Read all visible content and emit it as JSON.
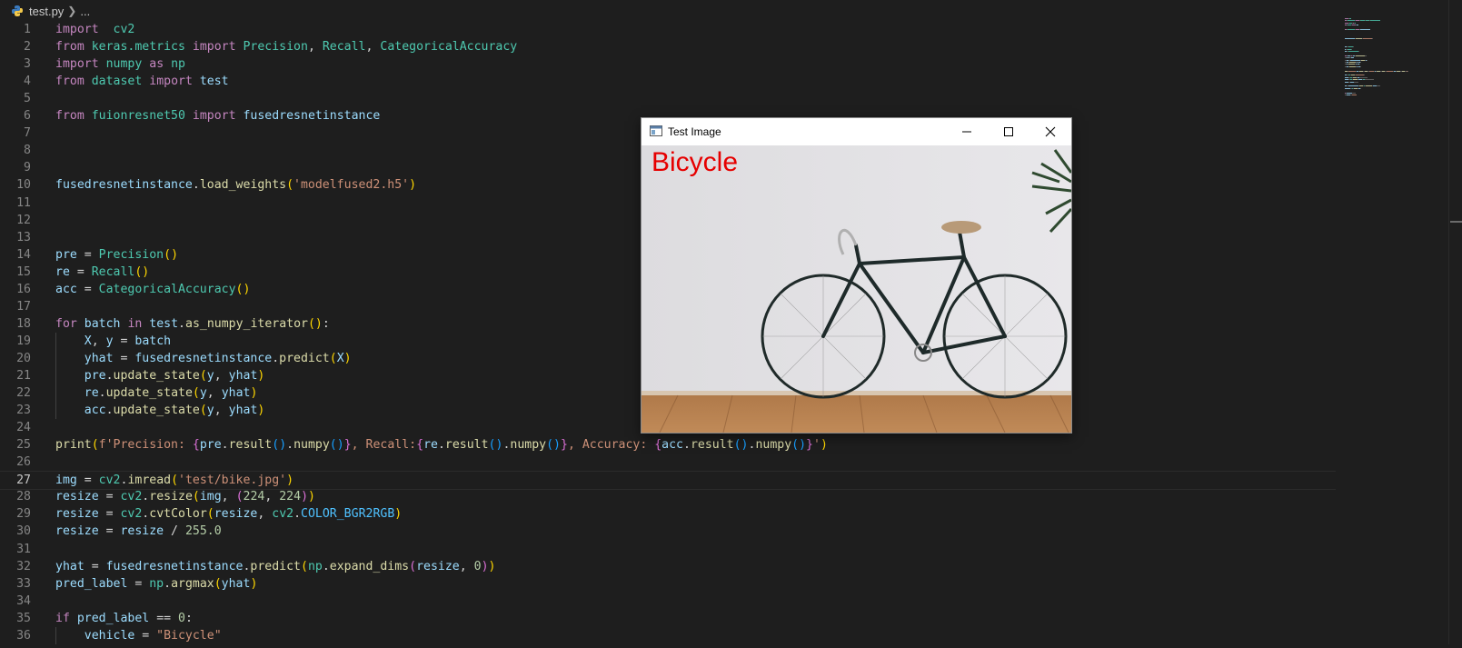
{
  "breadcrumb": {
    "file": "test.py",
    "more": "..."
  },
  "editor": {
    "active_line": 27,
    "lines": [
      {
        "n": "1",
        "tokens": [
          [
            "k",
            "import"
          ],
          [
            "",
            "  "
          ],
          [
            "c",
            "cv2"
          ]
        ]
      },
      {
        "n": "2",
        "tokens": [
          [
            "k",
            "from"
          ],
          [
            "",
            ""
          ],
          [
            "c",
            "keras.metrics"
          ],
          [
            "",
            ""
          ],
          [
            "k",
            "import"
          ],
          [
            "",
            ""
          ],
          [
            "c",
            "Precision"
          ],
          [
            "",
            ", "
          ],
          [
            "c",
            "Recall"
          ],
          [
            "",
            ", "
          ],
          [
            "c",
            "CategoricalAccuracy"
          ]
        ]
      },
      {
        "n": "3",
        "tokens": [
          [
            "k",
            "import"
          ],
          [
            "",
            ""
          ],
          [
            "c",
            "numpy"
          ],
          [
            "",
            ""
          ],
          [
            "k",
            "as"
          ],
          [
            "",
            ""
          ],
          [
            "c",
            "np"
          ]
        ]
      },
      {
        "n": "4",
        "tokens": [
          [
            "k",
            "from"
          ],
          [
            "",
            ""
          ],
          [
            "c",
            "dataset"
          ],
          [
            "",
            ""
          ],
          [
            "k",
            "import"
          ],
          [
            "",
            ""
          ],
          [
            "v",
            "test"
          ]
        ]
      },
      {
        "n": "5",
        "tokens": []
      },
      {
        "n": "6",
        "tokens": [
          [
            "k",
            "from"
          ],
          [
            "",
            ""
          ],
          [
            "c",
            "fuionresnet50"
          ],
          [
            "",
            ""
          ],
          [
            "k",
            "import"
          ],
          [
            "",
            ""
          ],
          [
            "v",
            "fusedresnetinstance"
          ]
        ]
      },
      {
        "n": "7",
        "tokens": []
      },
      {
        "n": "8",
        "tokens": []
      },
      {
        "n": "9",
        "tokens": []
      },
      {
        "n": "10",
        "tokens": [
          [
            "v",
            "fusedresnetinstance"
          ],
          [
            "",
            "."
          ],
          [
            "f",
            "load_weights"
          ],
          [
            "b1",
            "("
          ],
          [
            "s",
            "'modelfused2.h5'"
          ],
          [
            "b1",
            ")"
          ]
        ]
      },
      {
        "n": "11",
        "tokens": []
      },
      {
        "n": "12",
        "tokens": []
      },
      {
        "n": "13",
        "tokens": []
      },
      {
        "n": "14",
        "tokens": [
          [
            "v",
            "pre"
          ],
          [
            "",
            " = "
          ],
          [
            "c",
            "Precision"
          ],
          [
            "b1",
            "()"
          ]
        ]
      },
      {
        "n": "15",
        "tokens": [
          [
            "v",
            "re"
          ],
          [
            "",
            " = "
          ],
          [
            "c",
            "Recall"
          ],
          [
            "b1",
            "()"
          ]
        ]
      },
      {
        "n": "16",
        "tokens": [
          [
            "v",
            "acc"
          ],
          [
            "",
            " = "
          ],
          [
            "c",
            "CategoricalAccuracy"
          ],
          [
            "b1",
            "()"
          ]
        ]
      },
      {
        "n": "17",
        "tokens": []
      },
      {
        "n": "18",
        "tokens": [
          [
            "k",
            "for"
          ],
          [
            "",
            " "
          ],
          [
            "v",
            "batch"
          ],
          [
            "",
            " "
          ],
          [
            "k",
            "in"
          ],
          [
            "",
            " "
          ],
          [
            "v",
            "test"
          ],
          [
            "",
            "."
          ],
          [
            "f",
            "as_numpy_iterator"
          ],
          [
            "b1",
            "()"
          ],
          [
            "",
            ":"
          ]
        ]
      },
      {
        "n": "19",
        "tokens": [
          [
            "",
            "    "
          ],
          [
            "v",
            "X"
          ],
          [
            "",
            ", "
          ],
          [
            "v",
            "y"
          ],
          [
            "",
            " = "
          ],
          [
            "v",
            "batch"
          ]
        ]
      },
      {
        "n": "20",
        "tokens": [
          [
            "",
            "    "
          ],
          [
            "v",
            "yhat"
          ],
          [
            "",
            " = "
          ],
          [
            "v",
            "fusedresnetinstance"
          ],
          [
            "",
            "."
          ],
          [
            "f",
            "predict"
          ],
          [
            "b1",
            "("
          ],
          [
            "v",
            "X"
          ],
          [
            "b1",
            ")"
          ]
        ]
      },
      {
        "n": "21",
        "tokens": [
          [
            "",
            "    "
          ],
          [
            "v",
            "pre"
          ],
          [
            "",
            "."
          ],
          [
            "f",
            "update_state"
          ],
          [
            "b1",
            "("
          ],
          [
            "v",
            "y"
          ],
          [
            "",
            ", "
          ],
          [
            "v",
            "yhat"
          ],
          [
            "b1",
            ")"
          ]
        ]
      },
      {
        "n": "22",
        "tokens": [
          [
            "",
            "    "
          ],
          [
            "v",
            "re"
          ],
          [
            "",
            "."
          ],
          [
            "f",
            "update_state"
          ],
          [
            "b1",
            "("
          ],
          [
            "v",
            "y"
          ],
          [
            "",
            ", "
          ],
          [
            "v",
            "yhat"
          ],
          [
            "b1",
            ")"
          ]
        ]
      },
      {
        "n": "23",
        "tokens": [
          [
            "",
            "    "
          ],
          [
            "v",
            "acc"
          ],
          [
            "",
            "."
          ],
          [
            "f",
            "update_state"
          ],
          [
            "b1",
            "("
          ],
          [
            "v",
            "y"
          ],
          [
            "",
            ", "
          ],
          [
            "v",
            "yhat"
          ],
          [
            "b1",
            ")"
          ]
        ]
      },
      {
        "n": "24",
        "tokens": []
      },
      {
        "n": "25",
        "tokens": [
          [
            "f",
            "print"
          ],
          [
            "b1",
            "("
          ],
          [
            "s",
            "f'Precision: "
          ],
          [
            "b2",
            "{"
          ],
          [
            "v",
            "pre"
          ],
          [
            "",
            "."
          ],
          [
            "f",
            "result"
          ],
          [
            "b3",
            "()"
          ],
          [
            "",
            "."
          ],
          [
            "f",
            "numpy"
          ],
          [
            "b3",
            "()"
          ],
          [
            "b2",
            "}"
          ],
          [
            "s",
            ", Recall:"
          ],
          [
            "b2",
            "{"
          ],
          [
            "v",
            "re"
          ],
          [
            "",
            "."
          ],
          [
            "f",
            "result"
          ],
          [
            "b3",
            "()"
          ],
          [
            "",
            "."
          ],
          [
            "f",
            "numpy"
          ],
          [
            "b3",
            "()"
          ],
          [
            "b2",
            "}"
          ],
          [
            "s",
            ", Accuracy: "
          ],
          [
            "b2",
            "{"
          ],
          [
            "v",
            "acc"
          ],
          [
            "",
            "."
          ],
          [
            "f",
            "result"
          ],
          [
            "b3",
            "()"
          ],
          [
            "",
            "."
          ],
          [
            "f",
            "numpy"
          ],
          [
            "b3",
            "()"
          ],
          [
            "b2",
            "}"
          ],
          [
            "s",
            "'"
          ],
          [
            "b1",
            ")"
          ]
        ]
      },
      {
        "n": "26",
        "tokens": []
      },
      {
        "n": "27",
        "tokens": [
          [
            "v",
            "img"
          ],
          [
            "",
            " = "
          ],
          [
            "c",
            "cv2"
          ],
          [
            "",
            "."
          ],
          [
            "f",
            "imread"
          ],
          [
            "b1",
            "("
          ],
          [
            "s",
            "'test/bike.jpg'"
          ],
          [
            "b1",
            ")"
          ]
        ]
      },
      {
        "n": "28",
        "tokens": [
          [
            "v",
            "resize"
          ],
          [
            "",
            " = "
          ],
          [
            "c",
            "cv2"
          ],
          [
            "",
            "."
          ],
          [
            "f",
            "resize"
          ],
          [
            "b1",
            "("
          ],
          [
            "v",
            "img"
          ],
          [
            "",
            ", "
          ],
          [
            "b2",
            "("
          ],
          [
            "n",
            "224"
          ],
          [
            "",
            ", "
          ],
          [
            "n",
            "224"
          ],
          [
            "b2",
            ")"
          ],
          [
            "b1",
            ")"
          ]
        ]
      },
      {
        "n": "29",
        "tokens": [
          [
            "v",
            "resize"
          ],
          [
            "",
            " = "
          ],
          [
            "c",
            "cv2"
          ],
          [
            "",
            "."
          ],
          [
            "f",
            "cvtColor"
          ],
          [
            "b1",
            "("
          ],
          [
            "v",
            "resize"
          ],
          [
            "",
            ", "
          ],
          [
            "c",
            "cv2"
          ],
          [
            "",
            "."
          ],
          [
            "const",
            "COLOR_BGR2RGB"
          ],
          [
            "b1",
            ")"
          ]
        ]
      },
      {
        "n": "30",
        "tokens": [
          [
            "v",
            "resize"
          ],
          [
            "",
            " = "
          ],
          [
            "v",
            "resize"
          ],
          [
            "",
            " / "
          ],
          [
            "n",
            "255.0"
          ]
        ]
      },
      {
        "n": "31",
        "tokens": []
      },
      {
        "n": "32",
        "tokens": [
          [
            "v",
            "yhat"
          ],
          [
            "",
            " = "
          ],
          [
            "v",
            "fusedresnetinstance"
          ],
          [
            "",
            "."
          ],
          [
            "f",
            "predict"
          ],
          [
            "b1",
            "("
          ],
          [
            "c",
            "np"
          ],
          [
            "",
            "."
          ],
          [
            "f",
            "expand_dims"
          ],
          [
            "b2",
            "("
          ],
          [
            "v",
            "resize"
          ],
          [
            "",
            ", "
          ],
          [
            "n",
            "0"
          ],
          [
            "b2",
            ")"
          ],
          [
            "b1",
            ")"
          ]
        ]
      },
      {
        "n": "33",
        "tokens": [
          [
            "v",
            "pred_label"
          ],
          [
            "",
            " = "
          ],
          [
            "c",
            "np"
          ],
          [
            "",
            "."
          ],
          [
            "f",
            "argmax"
          ],
          [
            "b1",
            "("
          ],
          [
            "v",
            "yhat"
          ],
          [
            "b1",
            ")"
          ]
        ]
      },
      {
        "n": "34",
        "tokens": []
      },
      {
        "n": "35",
        "tokens": [
          [
            "k",
            "if"
          ],
          [
            "",
            " "
          ],
          [
            "v",
            "pred_label"
          ],
          [
            "",
            " == "
          ],
          [
            "n",
            "0"
          ],
          [
            "",
            ":"
          ]
        ]
      },
      {
        "n": "36",
        "tokens": [
          [
            "",
            "    "
          ],
          [
            "v",
            "vehicle"
          ],
          [
            "",
            " = "
          ],
          [
            "s",
            "\"Bicycle\""
          ]
        ]
      }
    ]
  },
  "popup": {
    "title": "Test Image",
    "prediction": "Bicycle",
    "minimize_icon": "minimize-icon",
    "maximize_icon": "maximize-icon",
    "close_icon": "close-icon"
  },
  "colors": {
    "background": "#1e1e1e",
    "keyword": "#c586c0",
    "variable": "#9cdcfe",
    "function": "#dcdcaa",
    "class": "#4ec9b0",
    "string": "#ce9178",
    "number": "#b5cea8",
    "prediction_text": "#e60000"
  }
}
